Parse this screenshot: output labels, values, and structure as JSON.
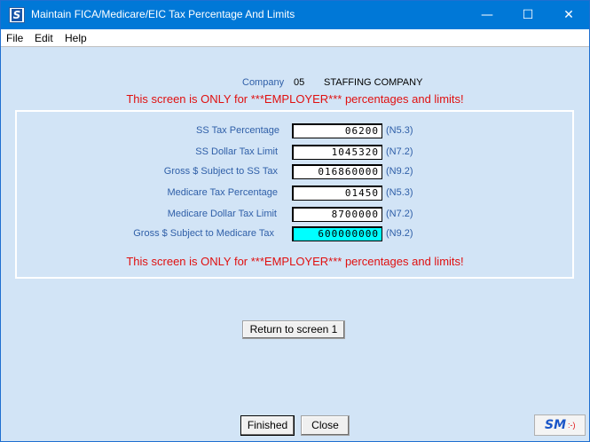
{
  "window": {
    "title": "Maintain FICA/Medicare/EIC Tax Percentage And Limits",
    "app_icon_letter": "S",
    "minimize_glyph": "—",
    "maximize_glyph": "☐",
    "close_glyph": "✕"
  },
  "menu": {
    "file": "File",
    "edit": "Edit",
    "help": "Help"
  },
  "company": {
    "label": "Company",
    "code": "05",
    "name": "STAFFING COMPANY"
  },
  "warning": "This screen is ONLY for ***EMPLOYER*** percentages and limits!",
  "fields": [
    {
      "label": "SS Tax Percentage",
      "value": "06200",
      "format": "(N5.3)"
    },
    {
      "label": "SS Dollar Tax Limit",
      "value": "1045320",
      "format": "(N7.2)"
    },
    {
      "label": "Gross $ Subject to SS Tax",
      "value": "016860000",
      "format": "(N9.2)"
    },
    {
      "label": "Medicare Tax Percentage",
      "value": "01450",
      "format": "(N5.3)"
    },
    {
      "label": "Medicare Dollar Tax Limit",
      "value": "8700000",
      "format": "(N7.2)"
    },
    {
      "label": "Gross $ Subject to Medicare Tax",
      "value": "600000000",
      "format": "(N9.2)"
    }
  ],
  "buttons": {
    "return": "Return to screen 1",
    "finished": "Finished",
    "close": "Close"
  },
  "logo": {
    "text": "SM",
    "smile": ":-)"
  },
  "colors": {
    "titlebar": "#0078d7",
    "background": "#d2e4f6",
    "label": "#2f5fa8",
    "warning": "#e01010",
    "active_field": "#00ffff"
  }
}
